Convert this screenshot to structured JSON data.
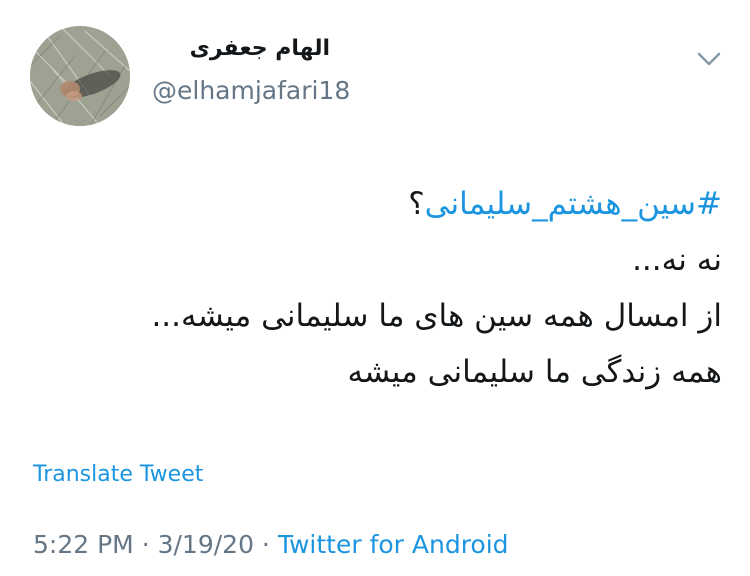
{
  "author": {
    "display_name": "الهام جعفری",
    "handle": "@elhamjafari18",
    "avatar_icon": "profile-avatar"
  },
  "menu_icon": "chevron-down-icon",
  "tweet": {
    "hashtag": "#سین_هشتم_سلیمانی",
    "hashtag_suffix": "؟",
    "lines": [
      "نه نه...",
      "از امسال همه سین های ما سلیمانی میشه...",
      "همه زندگی ما سلیمانی میشه"
    ]
  },
  "translate_label": "Translate Tweet",
  "meta": {
    "time": "5:22 PM",
    "separator": "·",
    "date": "3/19/20",
    "source": "Twitter for Android"
  },
  "colors": {
    "link": "#1b95e0",
    "secondary": "#657786",
    "text": "#14171a"
  }
}
